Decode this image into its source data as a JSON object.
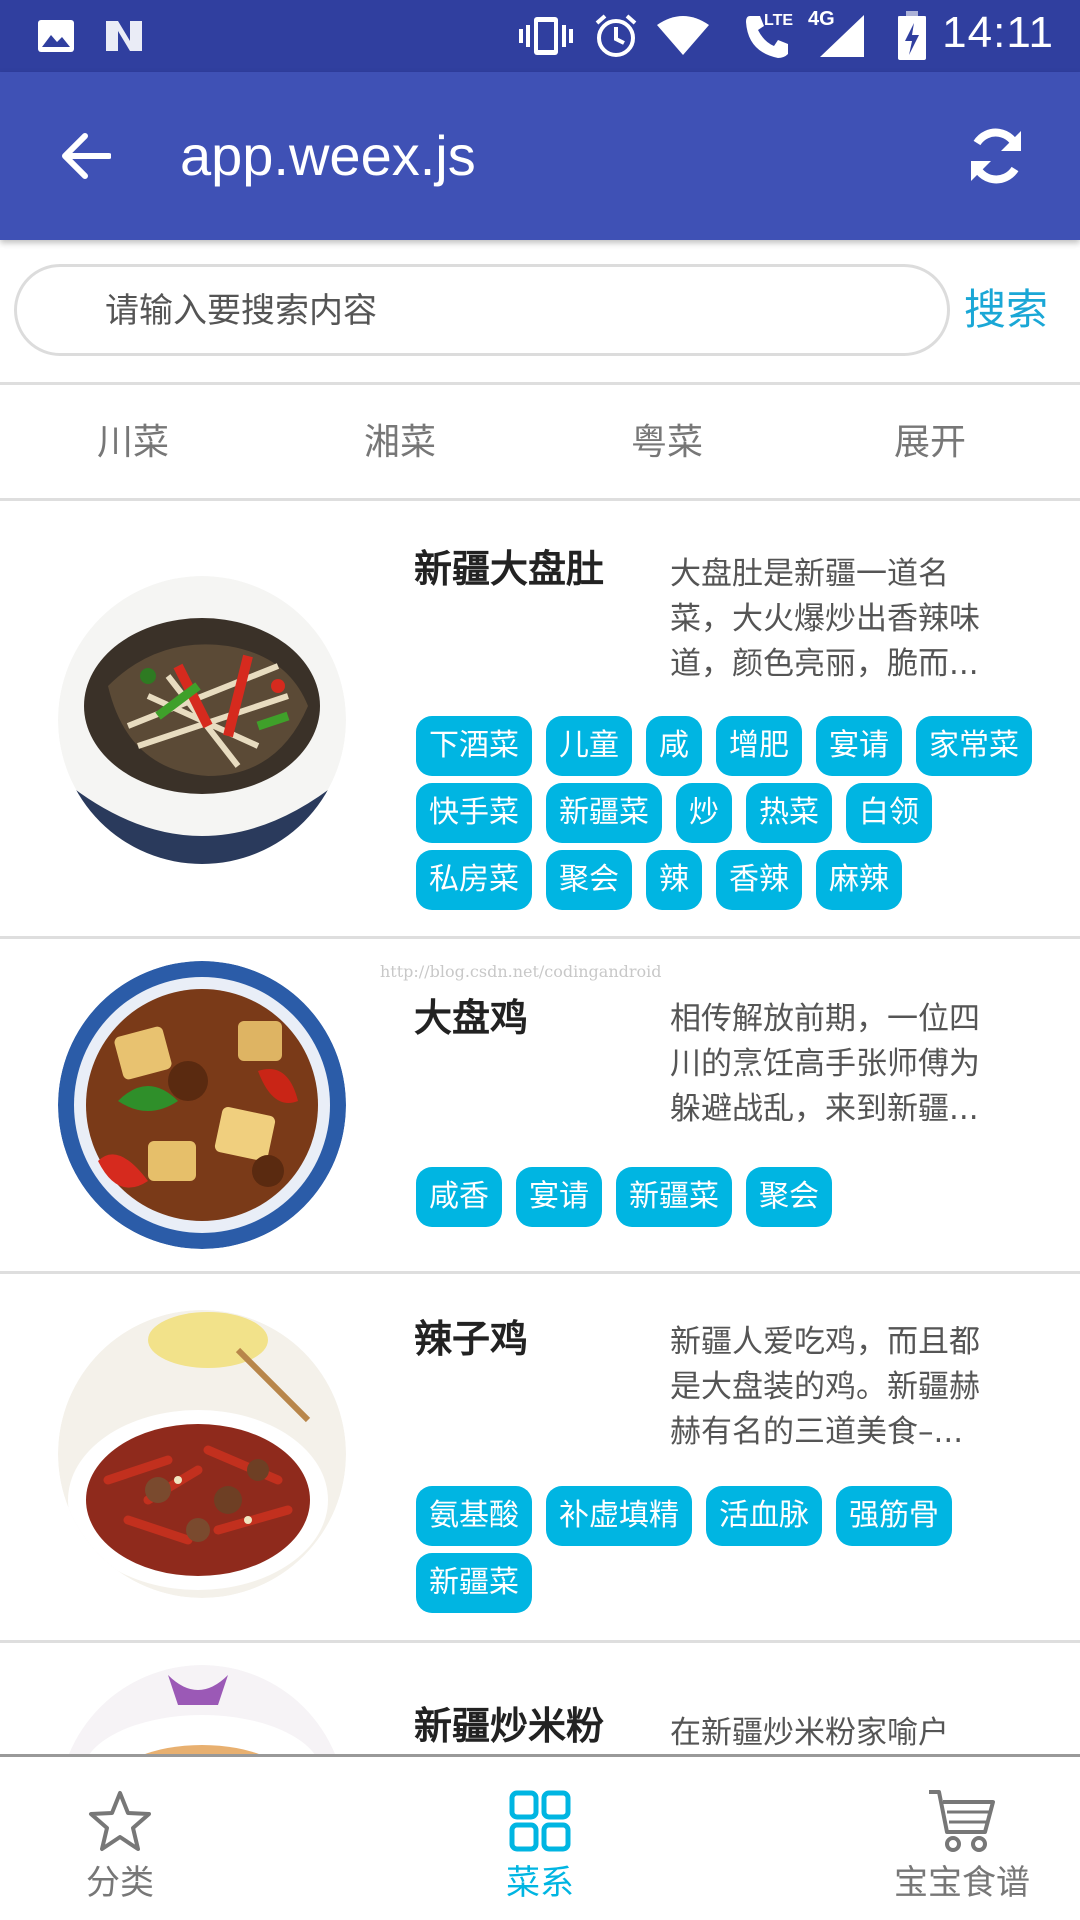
{
  "status_bar": {
    "time": "14:11",
    "network_lte": "LTE",
    "network_4g": "4G",
    "icons": [
      "image-icon",
      "n-icon",
      "vibrate-icon",
      "alarm-icon",
      "wifi-icon",
      "phone-lte-icon",
      "signal-icon",
      "battery-charging-icon"
    ]
  },
  "app_bar": {
    "title": "app.weex.js",
    "back_icon": "arrow-back-icon",
    "refresh_icon": "refresh-icon"
  },
  "search": {
    "placeholder": "请输入要搜索内容",
    "button_label": "搜索"
  },
  "categories": [
    "川菜",
    "湘菜",
    "粤菜",
    "展开"
  ],
  "dishes": [
    {
      "name": "新疆大盘肚",
      "description": "大盘肚是新疆一道名菜，大火爆炒出香辣味道，颜色亮丽，脆而...",
      "tags": [
        "下酒菜",
        "儿童",
        "咸",
        "增肥",
        "宴请",
        "家常菜",
        "快手菜",
        "新疆菜",
        "炒",
        "热菜",
        "白领",
        "私房菜",
        "聚会",
        "辣",
        "香辣",
        "麻辣"
      ]
    },
    {
      "name": "大盘鸡",
      "description": "相传解放前期，一位四川的烹饪高手张师傅为躲避战乱，来到新疆...",
      "tags": [
        "咸香",
        "宴请",
        "新疆菜",
        "聚会"
      ]
    },
    {
      "name": "辣子鸡",
      "description": "新疆人爱吃鸡，而且都是大盘装的鸡。新疆赫赫有名的三道美食–...",
      "tags": [
        "氨基酸",
        "补虚填精",
        "活血脉",
        "强筋骨",
        "新疆菜"
      ]
    },
    {
      "name": "新疆炒米粉",
      "description": "在新疆炒米粉家喻户",
      "tags": []
    }
  ],
  "watermark": "http://blog.csdn.net/codingandroid",
  "bottom_nav": [
    {
      "label": "分类",
      "icon": "star-icon",
      "active": false
    },
    {
      "label": "菜系",
      "icon": "grid-icon",
      "active": true
    },
    {
      "label": "宝宝食谱",
      "icon": "cart-icon",
      "active": false
    }
  ],
  "colors": {
    "status_bar": "#303f9f",
    "app_bar": "#3f51b5",
    "accent": "#00b5e2",
    "search_button": "#1aa7d6",
    "inactive": "#777777"
  }
}
